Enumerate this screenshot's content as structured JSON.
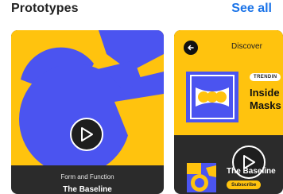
{
  "section": {
    "title": "Prototypes",
    "see_all": "See all"
  },
  "cards": [
    {
      "subtitle": "Form and Function",
      "title": "The Baseline",
      "play_icon": "play-icon"
    },
    {
      "header": "Discover",
      "back_icon": "arrow-left-icon",
      "badge": "TRENDIN",
      "story_title": "Inside\nMasks",
      "channel": "The Baseline",
      "subscribe": "Subscribe",
      "play_icon": "play-icon"
    }
  ],
  "colors": {
    "accent": "#1a73e8",
    "yellow": "#ffc30e",
    "blue": "#4b54f0",
    "dark": "#2b2b2b"
  }
}
